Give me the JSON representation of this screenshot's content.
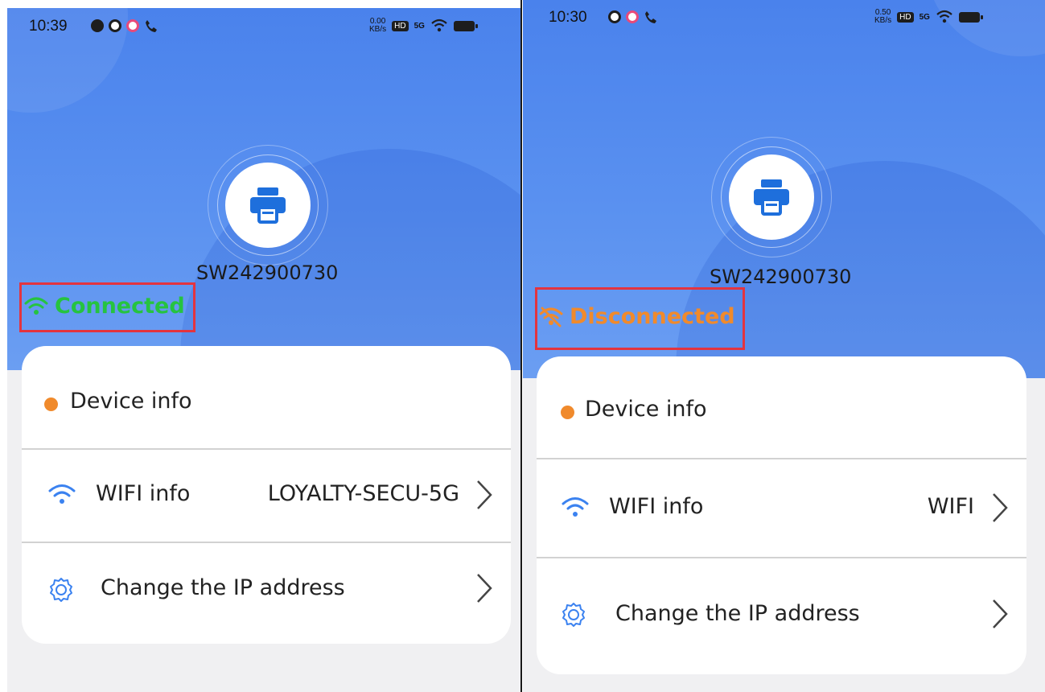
{
  "left_screen": {
    "status_time": "10:39",
    "status_speed_value": "0.00",
    "status_speed_unit": "KB/s",
    "status_hd": "HD",
    "status_signal": "5G",
    "device_id": "SW242900730",
    "connection_status": "Connected",
    "rows": {
      "device_info": "Device info",
      "wifi_label": "WIFI info",
      "wifi_value": "LOYALTY-SECU-5G",
      "ip_label": "Change the IP address"
    }
  },
  "right_screen": {
    "status_time": "10:30",
    "status_speed_value": "0.50",
    "status_speed_unit": "KB/s",
    "status_hd": "HD",
    "status_signal": "5G",
    "device_id": "SW242900730",
    "connection_status": "Disconnected",
    "rows": {
      "device_info": "Device info",
      "wifi_label": "WIFI info",
      "wifi_value": "WIFI",
      "ip_label": "Change the IP address"
    }
  },
  "colors": {
    "hero_blue": "#4a82ec",
    "connected_green": "#26c340",
    "disconnected_orange": "#f08a2c",
    "highlight_red": "#e3343f",
    "icon_blue": "#3b82f0"
  },
  "icons": [
    "printer-icon",
    "wifi-icon",
    "wifi-off-icon",
    "settings-gear-icon",
    "chevron-right-icon"
  ]
}
